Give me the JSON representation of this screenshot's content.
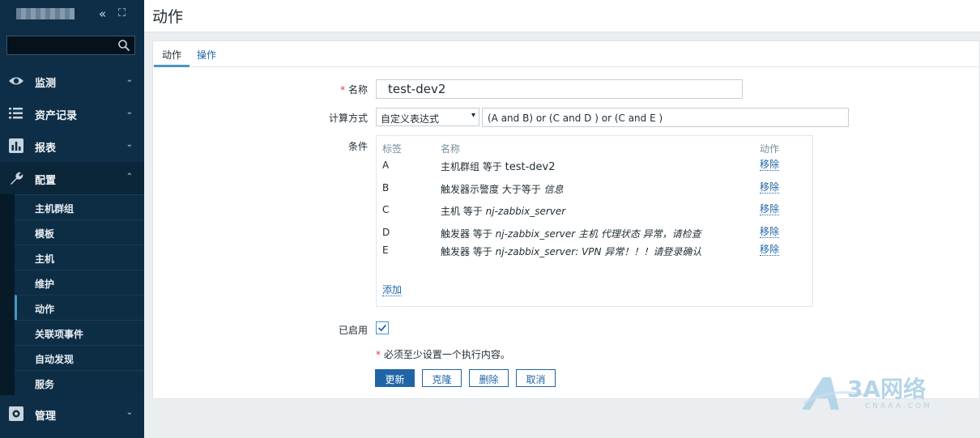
{
  "sidebar": {
    "search_placeholder": "",
    "menu": [
      {
        "label": "监测",
        "icon": "eye-icon"
      },
      {
        "label": "资产记录",
        "icon": "list-icon"
      },
      {
        "label": "报表",
        "icon": "bar-chart-icon"
      },
      {
        "label": "配置",
        "icon": "wrench-icon"
      },
      {
        "label": "管理",
        "icon": "gear-icon"
      }
    ],
    "config_sub": [
      "主机群组",
      "模板",
      "主机",
      "维护",
      "动作",
      "关联项事件",
      "自动发现",
      "服务"
    ],
    "active_sub": "动作"
  },
  "header": {
    "title": "动作"
  },
  "tabs": [
    {
      "label": "动作"
    },
    {
      "label": "操作"
    }
  ],
  "form": {
    "name_label": "名称",
    "name_value": "test-dev2",
    "calc_label": "计算方式",
    "calc_value": "自定义表达式",
    "formula_value": "(A and B) or (C and D ) or (C and E )",
    "conditions_label": "条件",
    "conditions_headers": {
      "label": "标签",
      "name": "名称",
      "action": "动作"
    },
    "conditions": [
      {
        "label": "A",
        "prefix": "主机群组 等于 ",
        "value": "test-dev2",
        "italic": false,
        "action": "移除"
      },
      {
        "label": "B",
        "prefix": "触发器示警度 大于等于 ",
        "value": "信息",
        "italic": true,
        "action": "移除"
      },
      {
        "label": "C",
        "prefix": "主机 等于 ",
        "value": "nj-zabbix_server",
        "italic": true,
        "action": "移除"
      },
      {
        "label": "D",
        "prefix": "触发器 等于 ",
        "value": "nj-zabbix_server 主机 代理状态 异常，请检查",
        "italic": true,
        "action": "移除"
      },
      {
        "label": "E",
        "prefix": "触发器 等于 ",
        "value": "nj-zabbix_server: VPN 异常！！！请登录确认",
        "italic": true,
        "action": "移除"
      }
    ],
    "add_label": "添加",
    "enabled_label": "已启用",
    "enabled": true,
    "note": "必须至少设置一个执行内容。"
  },
  "buttons": {
    "update": "更新",
    "clone": "克隆",
    "delete": "删除",
    "cancel": "取消"
  },
  "watermark": {
    "text": "3A网络",
    "sub": "CNAAA.COM"
  }
}
